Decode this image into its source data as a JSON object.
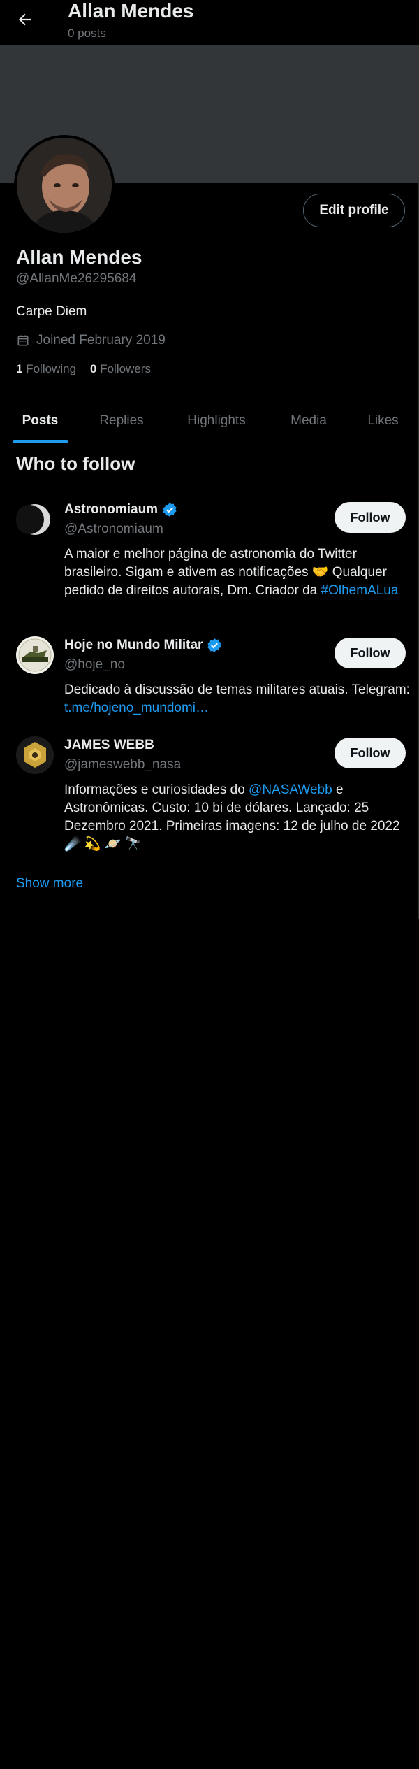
{
  "header": {
    "title": "Allan Mendes",
    "subtitle": "0 posts"
  },
  "profile": {
    "edit_label": "Edit profile",
    "name": "Allan Mendes",
    "handle": "@AllanMe26295684",
    "bio": "Carpe Diem",
    "joined": "Joined February 2019",
    "following_count": "1",
    "following_label": "Following",
    "followers_count": "0",
    "followers_label": "Followers"
  },
  "tabs": [
    {
      "label": "Posts"
    },
    {
      "label": "Replies"
    },
    {
      "label": "Highlights"
    },
    {
      "label": "Media"
    },
    {
      "label": "Likes"
    }
  ],
  "who_to_follow": {
    "title": "Who to follow",
    "follow_label": "Follow",
    "show_more": "Show more",
    "items": [
      {
        "name": "Astronomiaum",
        "handle": "@Astronomiaum",
        "bio": "A maior e melhor página de astronomia do Twitter brasileiro. Sigam e ativem as notificações 🤝 Qualquer pedido de direitos autorais, Dm. Criador da ",
        "bio_link": "#OlhemALua"
      },
      {
        "name": "Hoje no Mundo Militar",
        "handle": "@hoje_no",
        "bio": "Dedicado à discussão de temas militares atuais. Telegram: ",
        "bio_link": "t.me/hojeno_mundomi…"
      },
      {
        "name": "JAMES WEBB",
        "handle": "@jameswebb_nasa",
        "bio_pre": "Informações e curiosidades do ",
        "bio_link": "@NASAWebb",
        "bio_post": " e Astronômicas. Custo: 10 bi de dólares. Lançado: 25 Dezembro 2021. Primeiras imagens: 12 de julho de 2022 ☄️ 💫 🪐 🔭"
      }
    ]
  },
  "colors": {
    "accent": "#1d9bf0",
    "background": "#000000",
    "muted": "#71767b",
    "banner": "#333639"
  }
}
